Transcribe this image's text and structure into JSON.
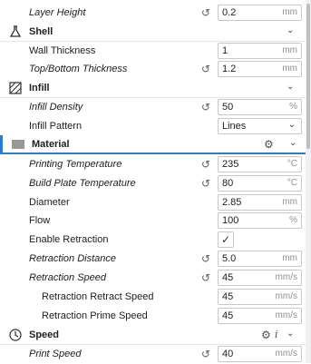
{
  "rows": {
    "layer_height": {
      "label": "Layer Height",
      "value": "0.2",
      "unit": "mm",
      "reset": "↺"
    },
    "wall_thickness": {
      "label": "Wall Thickness",
      "value": "1",
      "unit": "mm"
    },
    "top_bottom": {
      "label": "Top/Bottom Thickness",
      "value": "1.2",
      "unit": "mm",
      "reset": "↺"
    },
    "infill_density": {
      "label": "Infill Density",
      "value": "50",
      "unit": "%",
      "reset": "↺"
    },
    "infill_pattern": {
      "label": "Infill Pattern",
      "value": "Lines",
      "chevron": "⌄"
    },
    "print_temp": {
      "label": "Printing Temperature",
      "value": "235",
      "unit": "°C",
      "reset": "↺"
    },
    "plate_temp": {
      "label": "Build Plate Temperature",
      "value": "80",
      "unit": "°C",
      "reset": "↺"
    },
    "diameter": {
      "label": "Diameter",
      "value": "2.85",
      "unit": "mm"
    },
    "flow": {
      "label": "Flow",
      "value": "100",
      "unit": "%"
    },
    "enable_retraction": {
      "label": "Enable Retraction",
      "check": "✓"
    },
    "retraction_distance": {
      "label": "Retraction Distance",
      "value": "5.0",
      "unit": "mm",
      "reset": "↺"
    },
    "retraction_speed": {
      "label": "Retraction Speed",
      "value": "45",
      "unit": "mm/s",
      "reset": "↺"
    },
    "retract_speed": {
      "label": "Retraction Retract Speed",
      "value": "45",
      "unit": "mm/s"
    },
    "prime_speed": {
      "label": "Retraction Prime Speed",
      "value": "45",
      "unit": "mm/s"
    },
    "print_speed": {
      "label": "Print Speed",
      "value": "40",
      "unit": "mm/s",
      "reset": "↺"
    }
  },
  "categories": {
    "shell": {
      "title": "Shell",
      "icon": "shell-icon",
      "chevron": "⌄"
    },
    "infill": {
      "title": "Infill",
      "icon": "infill-icon",
      "chevron": "⌄"
    },
    "material": {
      "title": "Material",
      "icon": "material-icon",
      "chevron": "⌄",
      "gear": "⚙"
    },
    "speed": {
      "title": "Speed",
      "icon": "speed-icon",
      "chevron": "⌄",
      "gear": "⚙",
      "info": "i"
    }
  },
  "colors": {
    "accent": "#2a7bd6",
    "border": "#c8c8c8"
  }
}
